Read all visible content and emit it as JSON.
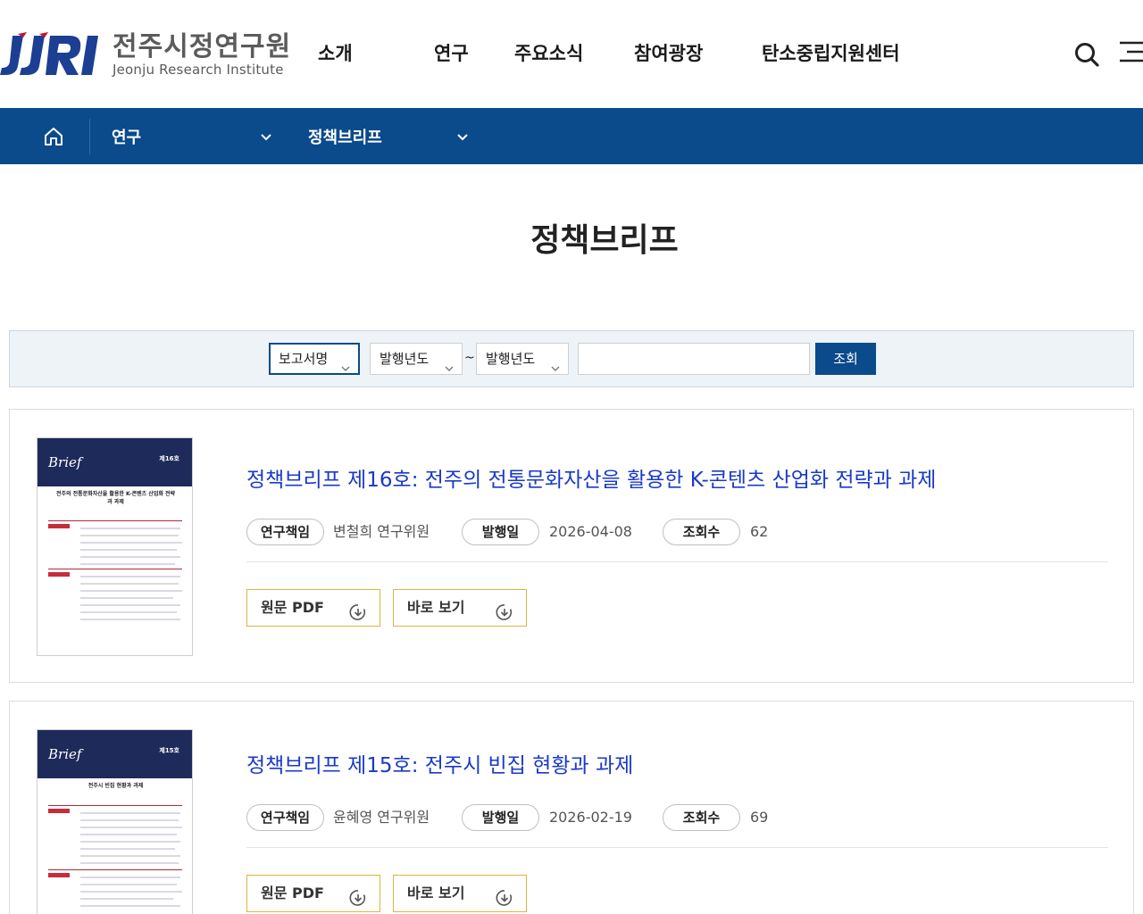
{
  "header": {
    "logo_kr": "전주시정연구원",
    "logo_en": "Jeonju Research Institute",
    "nav": [
      "소개",
      "연구",
      "주요소식",
      "참여광장",
      "탄소중립지원센터"
    ],
    "search_icon": "search-icon",
    "menu_icon": "hamburger-menu-icon"
  },
  "location": {
    "home_icon": "home-icon",
    "level1": "연구",
    "level2": "정책브리프"
  },
  "page": {
    "title": "정책브리프"
  },
  "search": {
    "field_select": "보고서명",
    "year_from": "발행년도",
    "tilde": "~",
    "year_to": "발행년도",
    "keyword_value": "",
    "submit_label": "조회"
  },
  "labels": {
    "author": "연구책임",
    "date": "발행일",
    "views": "조회수",
    "pdf_button": "원문 PDF",
    "view_button": "바로 보기"
  },
  "reports": [
    {
      "title": "정책브리프 제16호: 전주의 전통문화자산을 활용한 K-콘텐츠 산업화 전략과 과제",
      "author": "변철희 연구위원",
      "date": "2026-04-08",
      "views": "62",
      "thumb_no": "제16호",
      "thumb_title": "전주의 전통문화자산을 활용한 K-콘텐츠 산업화 전략과 과제"
    },
    {
      "title": "정책브리프 제15호: 전주시 빈집 현황과 과제",
      "author": "윤혜영 연구위원",
      "date": "2026-02-19",
      "views": "69",
      "thumb_no": "제15호",
      "thumb_title": "전주시 빈집 현황과 과제"
    }
  ],
  "thumb_brand": "Brief",
  "colors": {
    "primary": "#0b4a8b",
    "title_link": "#1a39c9",
    "button_border": "#e3b23c",
    "logo_blue": "#1c3f94",
    "logo_red": "#c8102e"
  }
}
